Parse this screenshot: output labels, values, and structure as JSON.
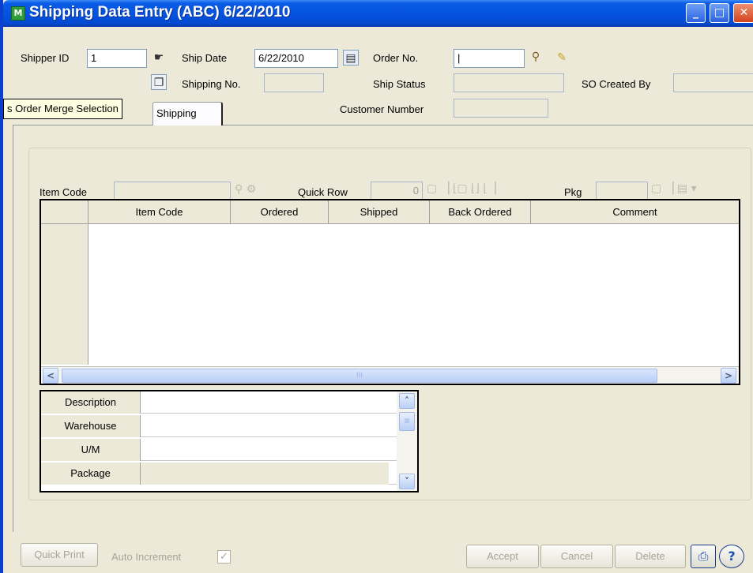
{
  "window": {
    "title": "Shipping Data Entry (ABC) 6/22/2010"
  },
  "titlebar": {
    "minimize": "_",
    "maximize": "□",
    "close": "✕",
    "app_icon": "M"
  },
  "header": {
    "shipper_id_label": "Shipper ID",
    "shipper_id_value": "1",
    "ship_date_label": "Ship Date",
    "ship_date_value": "6/22/2010",
    "order_no_label": "Order No.",
    "order_no_value": "|",
    "shipping_no_label": "Shipping No.",
    "ship_status_label": "Ship Status",
    "so_created_by_label": "SO Created By",
    "customer_number_label": "Customer Number"
  },
  "tooltip": {
    "text": "s Order Merge Selection"
  },
  "tabs": [
    {
      "label": "Shipping"
    }
  ],
  "entry": {
    "item_code_label": "Item Code",
    "quick_row_label": "Quick Row",
    "quick_row_value": "0",
    "pkg_label": "Pkg"
  },
  "grid": {
    "columns": [
      "Item Code",
      "Ordered",
      "Shipped",
      "Back Ordered",
      "Comment"
    ],
    "rows": []
  },
  "scroll": {
    "left": "<",
    "right": ">",
    "thumb_grip": "III"
  },
  "detail": {
    "rows": [
      {
        "label": "Description",
        "value": ""
      },
      {
        "label": "Warehouse",
        "value": ""
      },
      {
        "label": "U/M",
        "value": ""
      },
      {
        "label": "Package",
        "value": ""
      }
    ]
  },
  "footer": {
    "quick_print": "Quick Print",
    "auto_increment": "Auto Increment",
    "auto_increment_checked": "✓",
    "accept": "Accept",
    "cancel": "Cancel",
    "delete": "Delete"
  },
  "icons": {
    "lookup": "search-icon",
    "calendar": "calendar-icon",
    "print": "printer-icon",
    "help": "help-icon"
  },
  "colors": {
    "titlebar": "#0554e0",
    "window": "#ece9d8",
    "tooltip": "#ffffe1"
  }
}
